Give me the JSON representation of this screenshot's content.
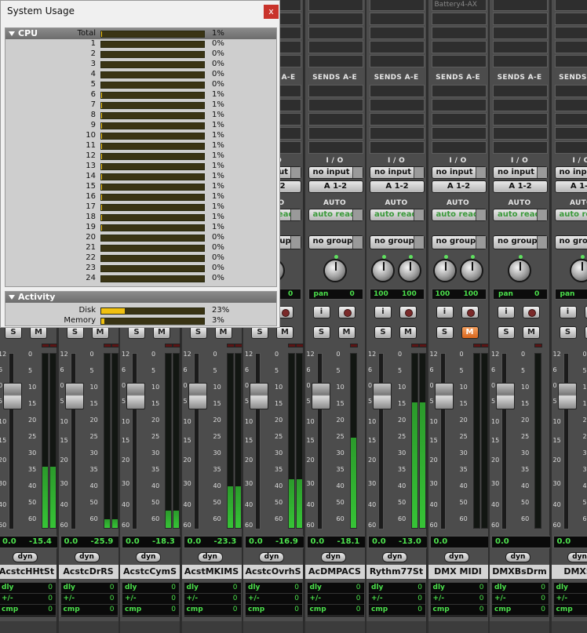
{
  "window": {
    "title": "System Usage",
    "close_label": "x"
  },
  "cpu": {
    "section_label": "CPU",
    "rows": [
      {
        "label": "Total",
        "pct": "1%",
        "value": 1
      },
      {
        "label": "1",
        "pct": "0%",
        "value": 0
      },
      {
        "label": "2",
        "pct": "0%",
        "value": 0
      },
      {
        "label": "3",
        "pct": "0%",
        "value": 0
      },
      {
        "label": "4",
        "pct": "0%",
        "value": 0
      },
      {
        "label": "5",
        "pct": "0%",
        "value": 0
      },
      {
        "label": "6",
        "pct": "1%",
        "value": 1
      },
      {
        "label": "7",
        "pct": "1%",
        "value": 1
      },
      {
        "label": "8",
        "pct": "1%",
        "value": 1
      },
      {
        "label": "9",
        "pct": "1%",
        "value": 1
      },
      {
        "label": "10",
        "pct": "1%",
        "value": 1
      },
      {
        "label": "11",
        "pct": "1%",
        "value": 1
      },
      {
        "label": "12",
        "pct": "1%",
        "value": 1
      },
      {
        "label": "13",
        "pct": "1%",
        "value": 1
      },
      {
        "label": "14",
        "pct": "1%",
        "value": 1
      },
      {
        "label": "15",
        "pct": "1%",
        "value": 1
      },
      {
        "label": "16",
        "pct": "1%",
        "value": 1
      },
      {
        "label": "17",
        "pct": "1%",
        "value": 1
      },
      {
        "label": "18",
        "pct": "1%",
        "value": 1
      },
      {
        "label": "19",
        "pct": "1%",
        "value": 1
      },
      {
        "label": "20",
        "pct": "0%",
        "value": 0
      },
      {
        "label": "21",
        "pct": "0%",
        "value": 0
      },
      {
        "label": "22",
        "pct": "0%",
        "value": 0
      },
      {
        "label": "23",
        "pct": "0%",
        "value": 0
      },
      {
        "label": "24",
        "pct": "0%",
        "value": 0
      }
    ]
  },
  "activity": {
    "section_label": "Activity",
    "rows": [
      {
        "label": "Disk",
        "pct": "23%",
        "value": 23
      },
      {
        "label": "Memory",
        "pct": "3%",
        "value": 3
      }
    ]
  },
  "mixer": {
    "sends_label": "SENDS A-E",
    "io_label": "I / O",
    "input_label": "no input",
    "output_label": "A 1-2",
    "auto_label": "AUTO",
    "auto_mode": "auto read",
    "group_label": "no group",
    "insert_plugin": "Battery4-AX",
    "input_button": "i",
    "solo_label": "S",
    "mute_label": "M",
    "dyn_label": "dyn",
    "dly_label": "dly",
    "plusminus_label": "+/-",
    "cmp_label": "cmp",
    "dly_value": "0",
    "scale_left": [
      "12",
      "6",
      "0",
      "5",
      "10",
      "15",
      "20",
      "30",
      "40",
      "60"
    ],
    "scale_right": [
      "0",
      "5",
      "10",
      "15",
      "20",
      "25",
      "30",
      "35",
      "40",
      "50",
      "60"
    ],
    "pan_center": "pan",
    "pan_value": "0",
    "pan_l100": "100",
    "pan_r100": "100",
    "volume": "0.0",
    "tracks": [
      {
        "name": "AcstcHHtSt",
        "peak": "-15.4",
        "level": 0.35
      },
      {
        "name": "AcstcDrRS",
        "peak": "-25.9",
        "level": 0.05
      },
      {
        "name": "AcstcCymS",
        "peak": "-18.3",
        "level": 0.1
      },
      {
        "name": "AcstMKIMS",
        "peak": "-23.3",
        "level": 0.24
      },
      {
        "name": "AcstcOvrhS",
        "peak": "-16.9",
        "level": 0.28
      },
      {
        "name": "AcDMPACS",
        "peak": "-18.1",
        "level": 0.52
      },
      {
        "name": "Rythm77St",
        "peak": "-13.0",
        "level": 0.72
      },
      {
        "name": "DMX MIDI",
        "peak": "",
        "level": 0
      },
      {
        "name": "DMXBsDrm",
        "peak": "",
        "level": 0
      },
      {
        "name": "DMXSn",
        "peak": "",
        "level": 0
      }
    ]
  }
}
